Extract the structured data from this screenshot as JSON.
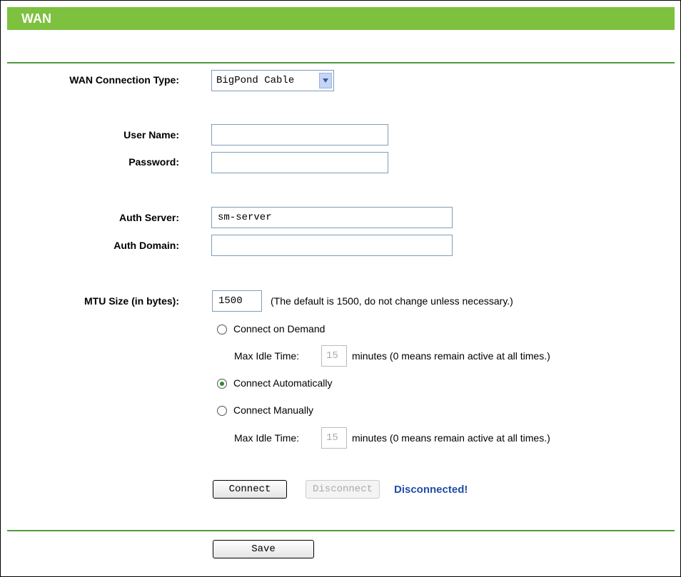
{
  "header": {
    "title": "WAN"
  },
  "form": {
    "connection_type": {
      "label": "WAN Connection Type:",
      "value": "BigPond Cable"
    },
    "user_name": {
      "label": "User Name:",
      "value": ""
    },
    "password": {
      "label": "Password:",
      "value": ""
    },
    "auth_server": {
      "label": "Auth Server:",
      "value": "sm-server"
    },
    "auth_domain": {
      "label": "Auth Domain:",
      "value": ""
    },
    "mtu": {
      "label": "MTU Size (in bytes):",
      "value": "1500",
      "hint": "(The default is 1500, do not change unless necessary.)"
    },
    "connect_on_demand": {
      "label": "Connect on Demand",
      "checked": false
    },
    "idle1": {
      "label": "Max Idle Time:",
      "value": "15",
      "suffix": "minutes (0 means remain active at all times.)"
    },
    "connect_auto": {
      "label": "Connect Automatically",
      "checked": true
    },
    "connect_manual": {
      "label": "Connect Manually",
      "checked": false
    },
    "idle2": {
      "label": "Max Idle Time:",
      "value": "15",
      "suffix": "minutes (0 means remain active at all times.)"
    }
  },
  "actions": {
    "connect_label": "Connect",
    "disconnect_label": "Disconnect",
    "status": "Disconnected!",
    "save_label": "Save"
  },
  "colors": {
    "header_bg": "#7dc13f",
    "rule": "#4f9a3c",
    "status": "#1f4ea8"
  }
}
